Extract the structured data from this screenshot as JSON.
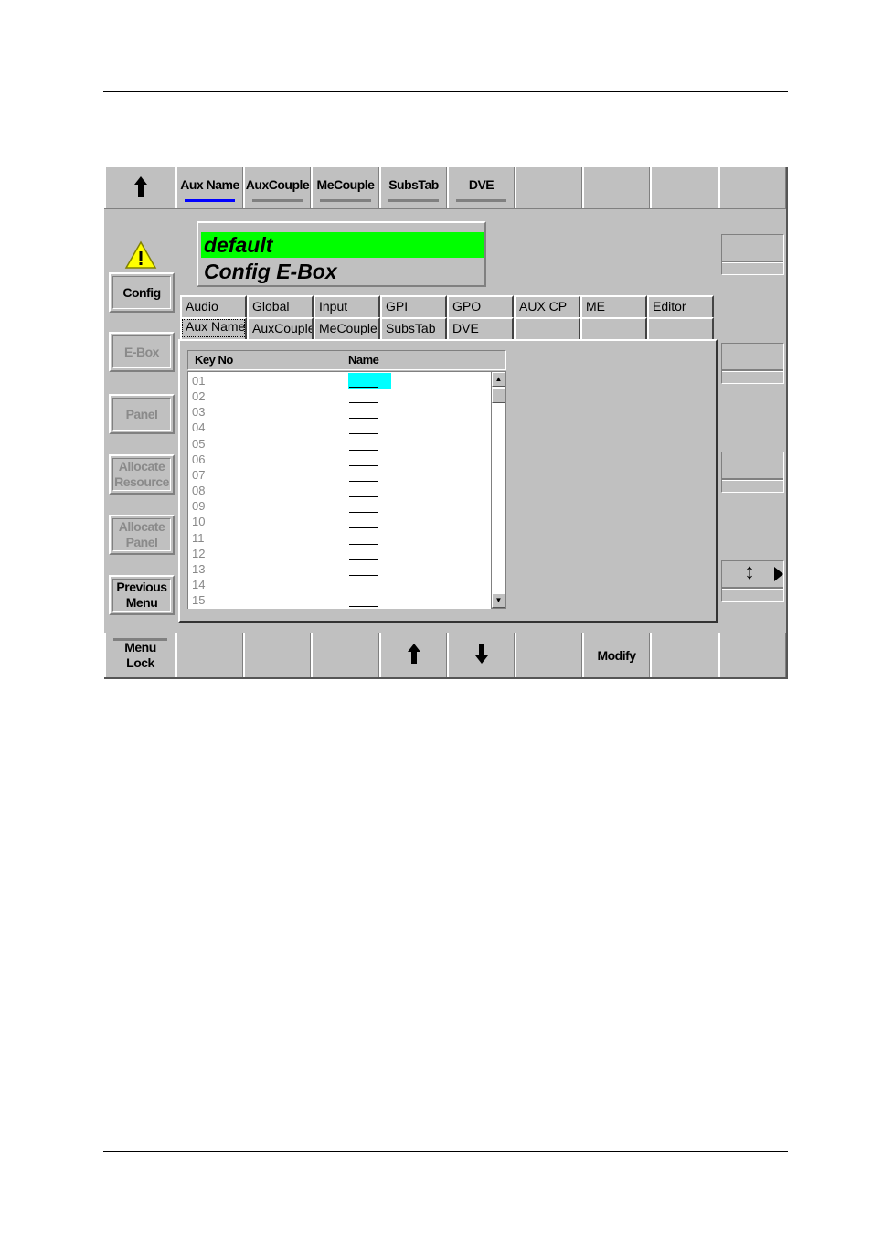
{
  "top_bar": {
    "items": [
      {
        "label": "",
        "icon": "arrow-up-icon"
      },
      {
        "label": "Aux Name",
        "active": true
      },
      {
        "label": "AuxCouple"
      },
      {
        "label": "MeCouple"
      },
      {
        "label": "SubsTab"
      },
      {
        "label": "DVE"
      },
      {
        "label": ""
      },
      {
        "label": ""
      },
      {
        "label": ""
      },
      {
        "label": ""
      }
    ]
  },
  "status": {
    "line1": "default",
    "line2": "Config E-Box",
    "highlight": "#00ff00"
  },
  "left_menu": {
    "warning_icon": "warning-icon",
    "buttons": [
      {
        "label": "Config",
        "enabled": true
      },
      {
        "label": "E-Box",
        "enabled": false
      },
      {
        "label": "Panel",
        "enabled": false
      },
      {
        "label": "Allocate Resource",
        "enabled": false
      },
      {
        "label": "Allocate Panel",
        "enabled": false
      },
      {
        "label": "Previous Menu",
        "enabled": true
      }
    ]
  },
  "tabs": {
    "row1": [
      "Audio",
      "Global",
      "Input",
      "GPI",
      "GPO",
      "AUX CP",
      "ME",
      "Editor"
    ],
    "row2": [
      "Aux Name",
      "AuxCouple",
      "MeCouple",
      "SubsTab",
      "DVE",
      "",
      "",
      ""
    ],
    "selected": "Aux Name"
  },
  "table": {
    "columns": [
      "Key No",
      "Name"
    ],
    "rows": [
      "01",
      "02",
      "03",
      "04",
      "05",
      "06",
      "07",
      "08",
      "09",
      "10",
      "11",
      "12",
      "13",
      "14",
      "15"
    ],
    "selected_row": "01",
    "selection_color": "#00ffff"
  },
  "right_panel": {
    "nav_icon": "up-down-arrow-icon",
    "next_icon": "triangle-right-icon"
  },
  "bottom_bar": {
    "items": [
      "Menu Lock",
      "",
      "",
      "",
      "arrow-up",
      "arrow-down",
      "",
      "Modify",
      "",
      ""
    ]
  },
  "colors": {
    "background": "#c0c0c0",
    "active_indicator": "#0000ff"
  }
}
